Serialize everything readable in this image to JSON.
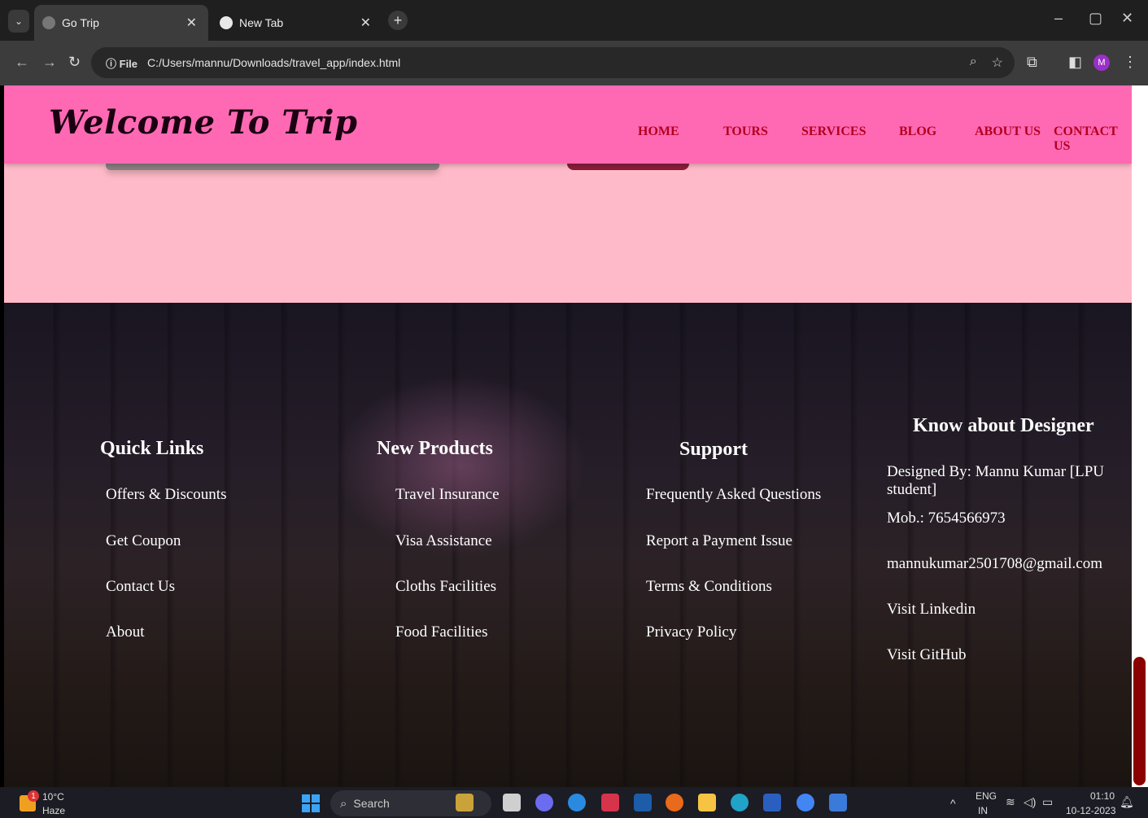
{
  "browser": {
    "tabs": [
      {
        "title": "Go Trip",
        "active": true
      },
      {
        "title": "New Tab",
        "active": false
      }
    ],
    "address": {
      "scheme_label": "File",
      "url": "C:/Users/mannu/Downloads/travel_app/index.html"
    },
    "profile_initial": "M"
  },
  "site": {
    "brand": "Welcome To Trip",
    "nav": [
      "HOME",
      "TOURS",
      "SERVICES",
      "BLOG",
      "ABOUT US",
      "CONTACT US"
    ]
  },
  "footer": {
    "quick_links": {
      "title": "Quick Links",
      "items": [
        "Offers & Discounts",
        "Get Coupon",
        "Contact Us",
        "About"
      ]
    },
    "new_products": {
      "title": "New Products",
      "items": [
        "Travel Insurance",
        "Visa Assistance",
        "Cloths Facilities",
        "Food Facilities"
      ]
    },
    "support": {
      "title": "Support",
      "items": [
        "Frequently Asked Questions",
        "Report a Payment Issue",
        "Terms & Conditions",
        "Privacy Policy"
      ]
    },
    "designer": {
      "title": "Know about Designer",
      "items": [
        "Designed By: Mannu Kumar [LPU student]",
        "Mob.: 7654566973",
        "mannukumar2501708@gmail.com",
        "Visit Linkedin",
        "Visit GitHub"
      ]
    }
  },
  "taskbar": {
    "weather": {
      "temp": "10°C",
      "condition": "Haze",
      "badge": "1"
    },
    "search_placeholder": "Search",
    "tray": {
      "lang": "ENG",
      "region": "IN",
      "time": "01:10",
      "date": "10-12-2023"
    }
  },
  "colors": {
    "header": "#ff69b4",
    "page_bg": "#ffbac9",
    "nav_text": "#b3001f",
    "scroll_thumb": "#8b0000"
  }
}
